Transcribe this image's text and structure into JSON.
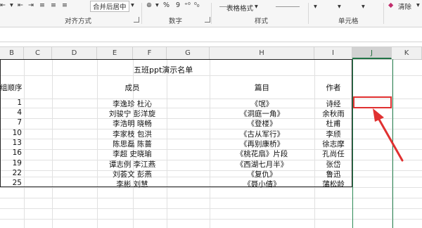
{
  "ribbon": {
    "align_label": "对齐方式",
    "merge_label": "合并后居中",
    "number_label": "数字",
    "percent_symbol": "%",
    "comma_symbol": "9",
    "table_format_label": "表格格式",
    "style_label": "样式",
    "cells_label": "单元格",
    "clear_label": "清除"
  },
  "columns": [
    "B",
    "C",
    "D",
    "E",
    "F",
    "G",
    "H",
    "I",
    "J",
    "K"
  ],
  "selected_column": "J",
  "sheet": {
    "title": "五班ppt演示名单",
    "headers": {
      "order": "组顺序",
      "members": "成员",
      "piece": "篇目",
      "author": "作者"
    },
    "rows": [
      {
        "order": "1",
        "members": "李逸珍 杜沁",
        "piece": "《氓》",
        "author": "诗经"
      },
      {
        "order": "4",
        "members": "刘骏宁 彭洋旋",
        "piece": "《洞庭一角》",
        "author": "余秋雨"
      },
      {
        "order": "7",
        "members": "李浩明 晓畅",
        "piece": "《登楼》",
        "author": "杜甫"
      },
      {
        "order": "10",
        "members": "李家枝 包洪",
        "piece": "《古从军行》",
        "author": "李颀"
      },
      {
        "order": "13",
        "members": "陈思磊 陈蔷",
        "piece": "《再别康桥》",
        "author": "徐志摩"
      },
      {
        "order": "16",
        "members": "李超 史晓瑜",
        "piece": "《桃花扇》片段",
        "author": "孔尚任"
      },
      {
        "order": "19",
        "members": "谭志例 李江燕",
        "piece": "《西湖七月半》",
        "author": "张岱"
      },
      {
        "order": "22",
        "members": "刘荟文 彭燕",
        "piece": "《复仇》",
        "author": "鲁迅"
      },
      {
        "order": "25",
        "members": "李彬 刘慧",
        "piece": "《聂小倩》",
        "author": "蒲松龄"
      }
    ]
  },
  "annotation_color": "#e03131",
  "accent_color": "#217346"
}
